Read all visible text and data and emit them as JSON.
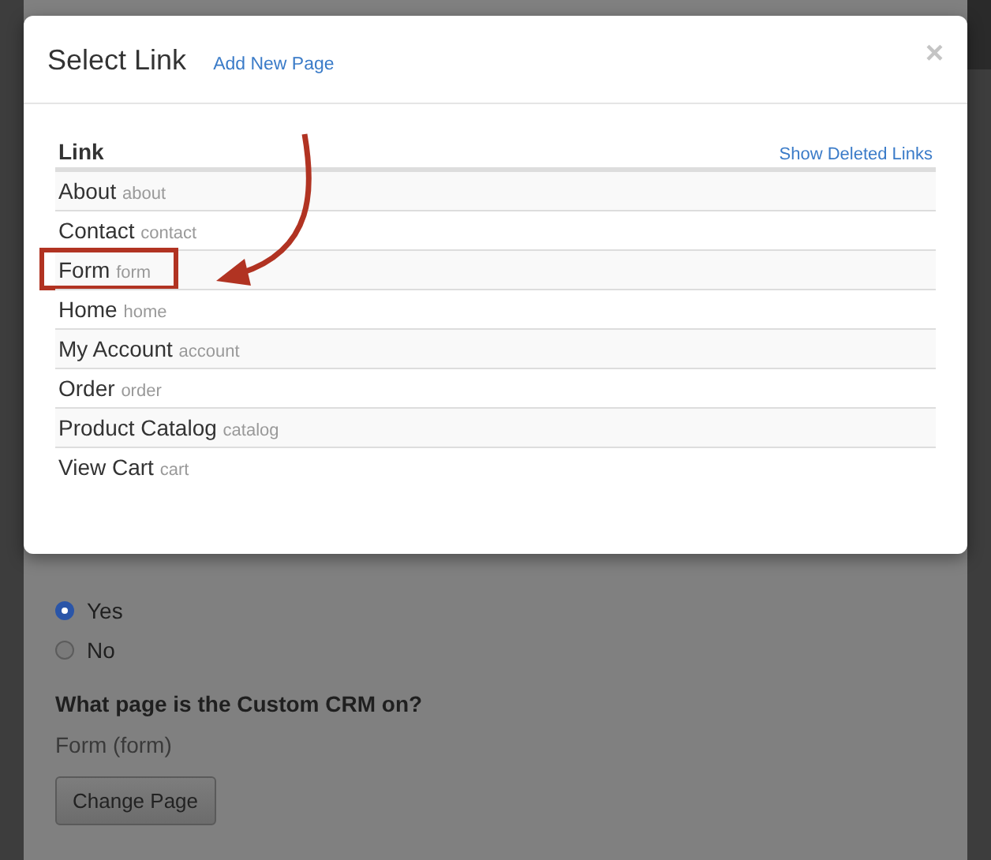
{
  "page": {
    "radios": [
      {
        "label": "Yes",
        "selected": true
      },
      {
        "label": "No",
        "selected": false
      }
    ],
    "question": "What page is the Custom CRM on?",
    "current_page": "Form (form)",
    "button": "Change Page"
  },
  "modal": {
    "title": "Select Link",
    "add_link": "Add New Page",
    "close": "×",
    "table": {
      "header": "Link",
      "show_deleted": "Show Deleted Links",
      "rows": [
        {
          "name": "About",
          "slug": "about",
          "highlighted": false
        },
        {
          "name": "Contact",
          "slug": "contact",
          "highlighted": false
        },
        {
          "name": "Form",
          "slug": "form",
          "highlighted": true
        },
        {
          "name": "Home",
          "slug": "home",
          "highlighted": false
        },
        {
          "name": "My Account",
          "slug": "account",
          "highlighted": false
        },
        {
          "name": "Order",
          "slug": "order",
          "highlighted": false
        },
        {
          "name": "Product Catalog",
          "slug": "catalog",
          "highlighted": false
        },
        {
          "name": "View Cart",
          "slug": "cart",
          "highlighted": false
        }
      ]
    }
  }
}
